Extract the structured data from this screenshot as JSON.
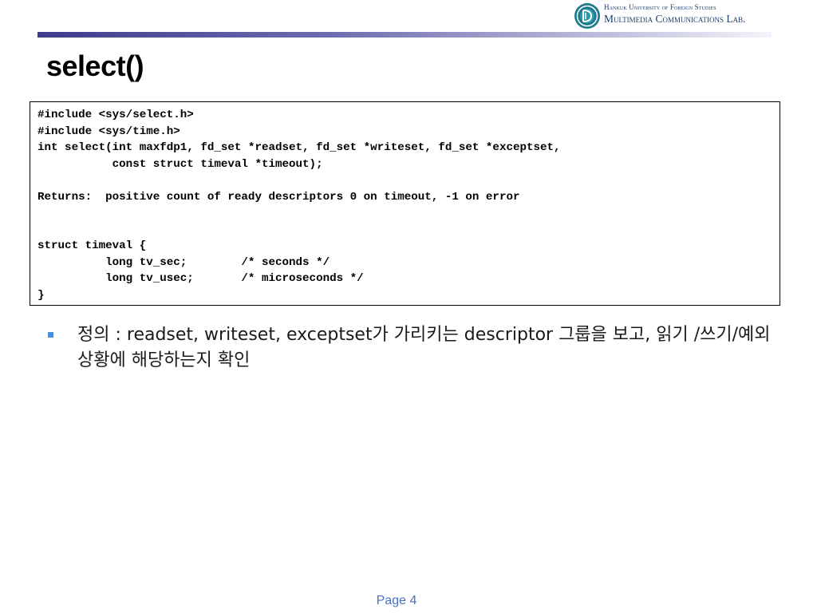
{
  "header": {
    "logo_line1": "Hankuk University of Foreign Studies",
    "logo_line2": "Multimedia Communications Lab."
  },
  "slide": {
    "title": "select()",
    "code_lines": [
      "#include <sys/select.h>",
      "#include <sys/time.h>",
      "int select(int maxfdp1, fd_set *readset, fd_set *writeset, fd_set *exceptset,",
      "           const struct timeval *timeout);",
      "",
      "Returns:  positive count of ready descriptors 0 on timeout, -1 on error",
      "",
      "",
      "struct timeval {",
      "          long tv_sec;        /* seconds */",
      "          long tv_usec;       /* microseconds */",
      "}"
    ],
    "bullet_text": "정의 : readset, writeset, exceptset가 가리키는 descriptor 그룹을 보고, 읽기 /쓰기/예외 상황에 해당하는지 확인"
  },
  "footer": {
    "page_label": "Page 4"
  },
  "colors": {
    "logo_text": "#1f3b6b",
    "header_bar_start": "#3c3c8c",
    "bullet": "#4a90d9",
    "page_number": "#4a6fc8"
  },
  "icons": {
    "logo": "university-emblem-icon",
    "bullet": "square-bullet-icon"
  }
}
